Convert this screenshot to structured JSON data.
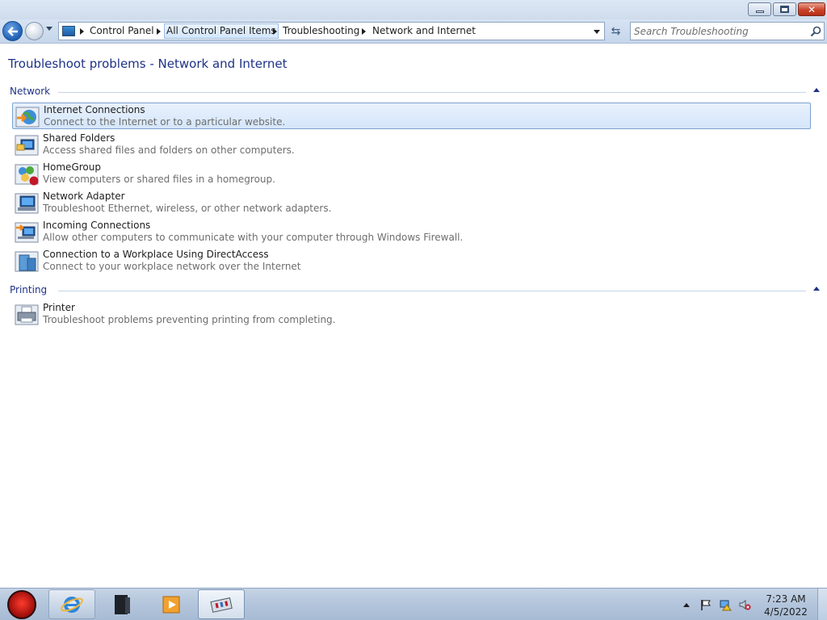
{
  "window": {
    "controls": {
      "minimize": "minimize",
      "maximize": "maximize",
      "close": "close"
    }
  },
  "address_bar": {
    "breadcrumbs": [
      "Control Panel",
      "All Control Panel Items",
      "Troubleshooting",
      "Network and Internet"
    ]
  },
  "search": {
    "placeholder": "Search Troubleshooting"
  },
  "page": {
    "title": "Troubleshoot problems - Network and Internet",
    "sections": [
      {
        "label": "Network",
        "items": [
          {
            "title": "Internet Connections",
            "description": "Connect to the Internet or to a particular website.",
            "icon": "globe-icon",
            "selected": true
          },
          {
            "title": "Shared Folders",
            "description": "Access shared files and folders on other computers.",
            "icon": "shared-folders-icon"
          },
          {
            "title": "HomeGroup",
            "description": "View computers or shared files in a homegroup.",
            "icon": "homegroup-icon"
          },
          {
            "title": "Network Adapter",
            "description": "Troubleshoot Ethernet, wireless, or other network adapters.",
            "icon": "network-adapter-icon"
          },
          {
            "title": "Incoming Connections",
            "description": "Allow other computers to communicate with your computer through Windows Firewall.",
            "icon": "incoming-connections-icon"
          },
          {
            "title": "Connection to a Workplace Using DirectAccess",
            "description": "Connect to your workplace network over the Internet",
            "icon": "directaccess-icon"
          }
        ]
      },
      {
        "label": "Printing",
        "items": [
          {
            "title": "Printer",
            "description": "Troubleshoot problems preventing printing from completing.",
            "icon": "printer-icon"
          }
        ]
      }
    ]
  },
  "taskbar": {
    "clock_time": "7:23 AM",
    "clock_date": "4/5/2022",
    "apps": [
      "internet-explorer-icon",
      "media-icon",
      "media-player-icon",
      "control-panel-icon"
    ]
  },
  "colors": {
    "accent": "#1e3287",
    "selection": "#d5e6fb",
    "muted_text": "#6d6d6d"
  }
}
